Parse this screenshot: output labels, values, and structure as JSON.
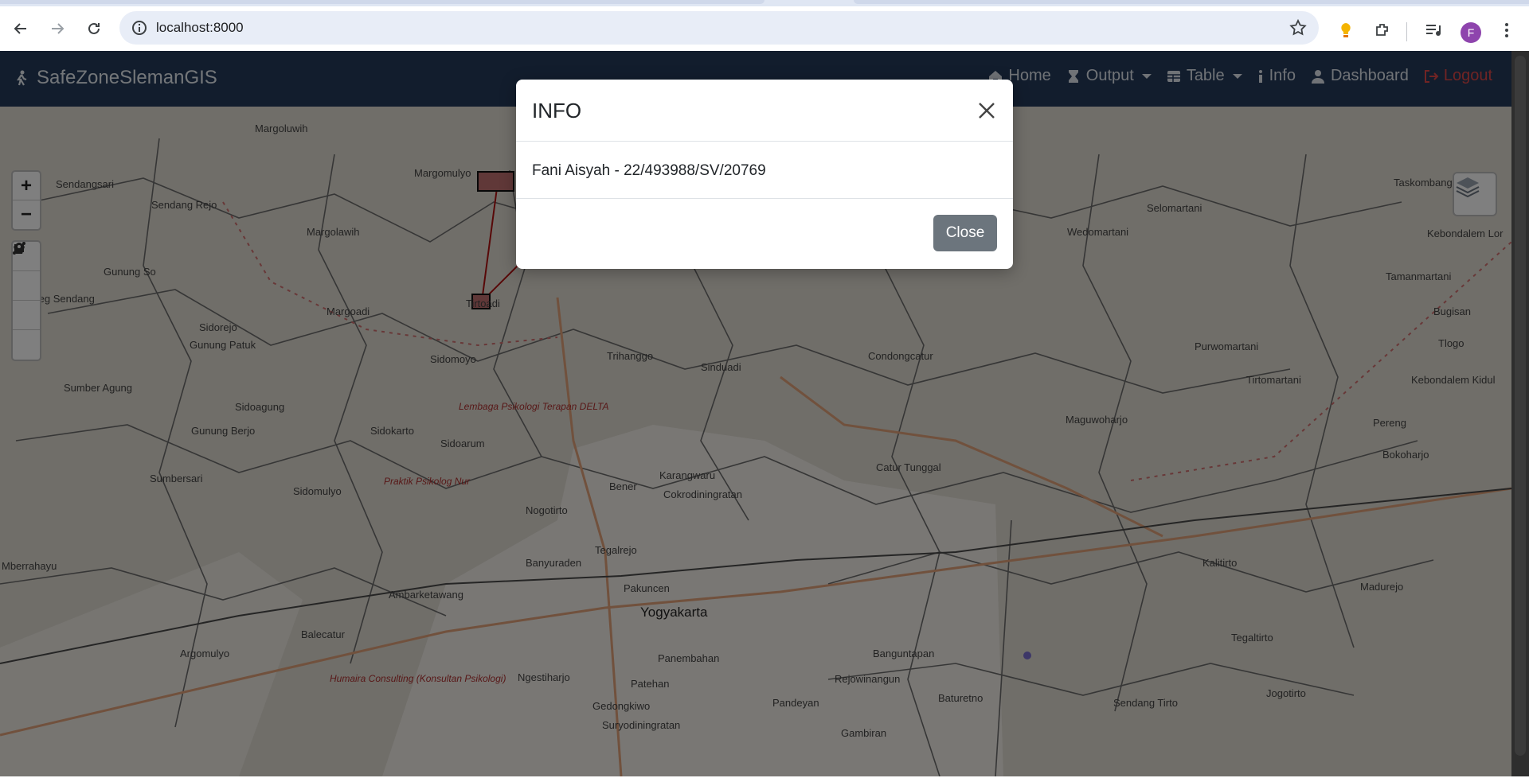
{
  "browser": {
    "url": "localhost:8000",
    "profile_initial": "F"
  },
  "navbar": {
    "brand": "SafeZoneSlemanGIS",
    "items": [
      {
        "label": "Home",
        "icon": "home-icon"
      },
      {
        "label": "Output",
        "icon": "hourglass-icon",
        "dropdown": true
      },
      {
        "label": "Table",
        "icon": "table-icon",
        "dropdown": true
      },
      {
        "label": "Info",
        "icon": "info-icon"
      },
      {
        "label": "Dashboard",
        "icon": "user-icon"
      },
      {
        "label": "Logout",
        "icon": "logout-icon"
      }
    ]
  },
  "map": {
    "zoom_in": "+",
    "zoom_out": "−",
    "labels": [
      "Margoluwih",
      "Margomulyo",
      "Sendangsari",
      "Sendang Rejo",
      "Margolawih",
      "Gunung So",
      "Seg Sendang",
      "Margoadi",
      "Sidorejo",
      "Gunung Patuk",
      "Sumber Agung",
      "Sidomoyo",
      "Sidoagung",
      "Gunung Berjo",
      "Sidokarto",
      "Sidoarum",
      "Sumbersari",
      "Sidomulyo",
      "Tirtoadi",
      "Trihanggo",
      "Sinduadi",
      "Condongcatur",
      "Wedomartani",
      "Selomartani",
      "Taskombang",
      "Tamanmartani",
      "Purwomartani",
      "Tirtomartani",
      "Maguwoharjo",
      "Catur Tunggal",
      "Karangwaru",
      "Cokrodiningratan",
      "Bener",
      "Nogotirto",
      "Tegalrejo",
      "Banyuraden",
      "Pakuncen",
      "Yogyakarta",
      "Ambarketawang",
      "Balecatur",
      "Argomulyo",
      "Ngestiharjo",
      "Panembahan",
      "Patehan",
      "Gedongkiwo",
      "Suryodiningratan",
      "Pandeyan",
      "Rejowinangun",
      "Banguntapan",
      "Baturetno",
      "Gambiran",
      "Kalitirto",
      "Madurejo",
      "Tegaltirto",
      "Sendang Tirto",
      "Jogotirto",
      "Bokoharjo",
      "Pereng",
      "Kebondalem Kidul",
      "Kebondalem Lor",
      "Bugisan",
      "Tlogo",
      "Mberrahayu"
    ],
    "poi": [
      "Lembaga Psikologi Terapan DELTA",
      "Praktik Psikolog Nur",
      "Humaira Consulting (Konsultan Psikologi)"
    ]
  },
  "modal": {
    "title": "INFO",
    "body": "Fani Aisyah - 22/493988/SV/20769",
    "close_button": "Close"
  }
}
